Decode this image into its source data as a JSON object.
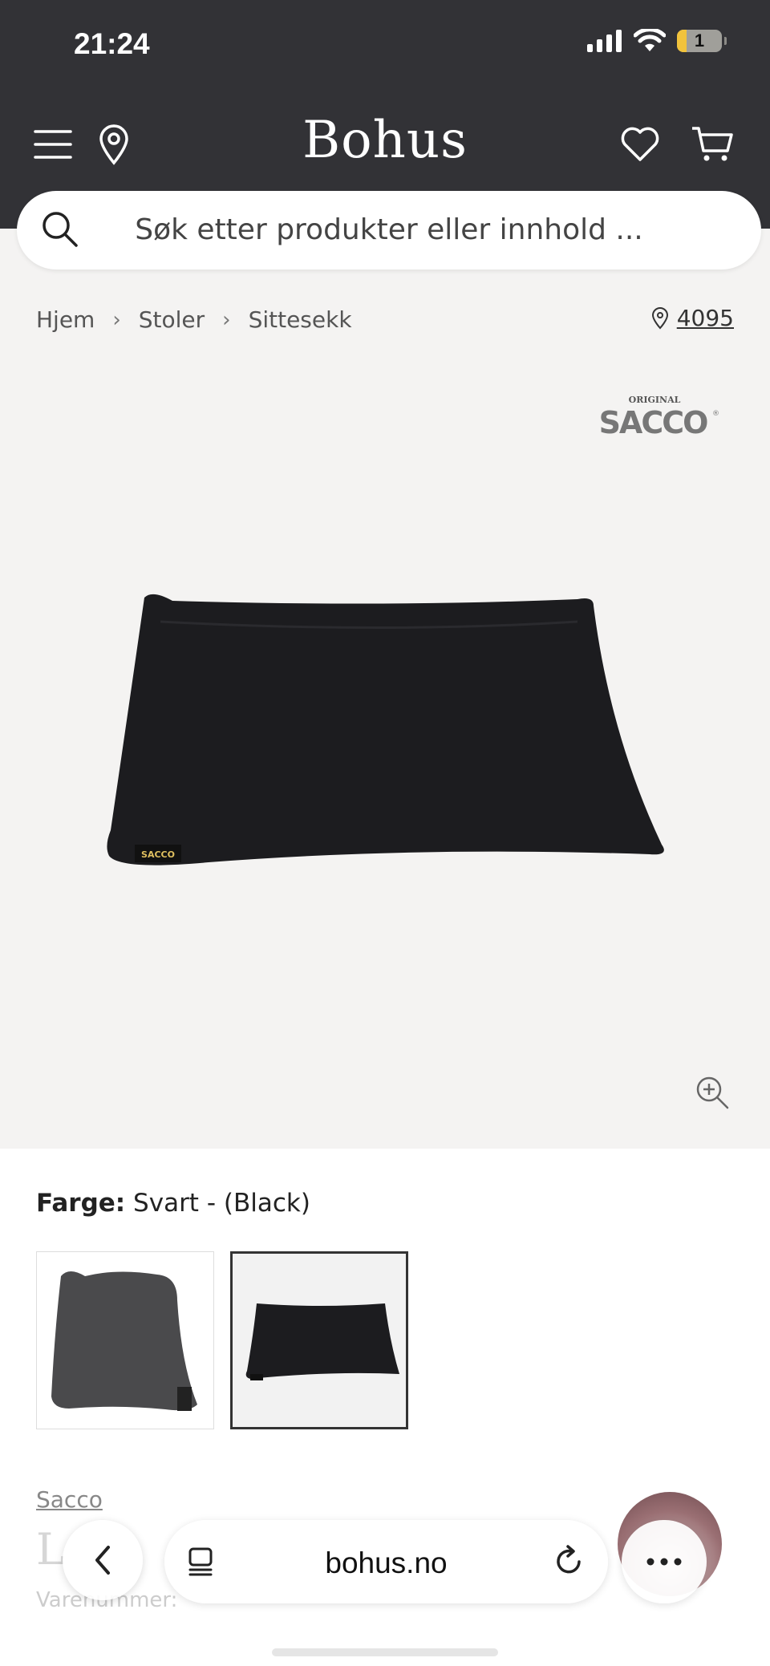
{
  "status_bar": {
    "time": "21:24",
    "battery": "1"
  },
  "header": {
    "logo": "Bohus"
  },
  "search": {
    "placeholder": "Søk etter produkter eller innhold ..."
  },
  "breadcrumb": {
    "items": [
      "Hjem",
      "Stoler",
      "Sittesekk"
    ]
  },
  "store": {
    "number": "4095"
  },
  "brand_logo": {
    "small": "ORIGINAL",
    "name": "SACCO"
  },
  "product": {
    "color_label": "Farge:",
    "color_value": "Svart - (Black)",
    "brand": "Sacco",
    "title_partial": "L",
    "sku_partial": "Varenummer:"
  },
  "browser": {
    "url": "bohus.no"
  },
  "colors": {
    "header_bg": "#323236",
    "page_bg": "#f4f3f2"
  }
}
